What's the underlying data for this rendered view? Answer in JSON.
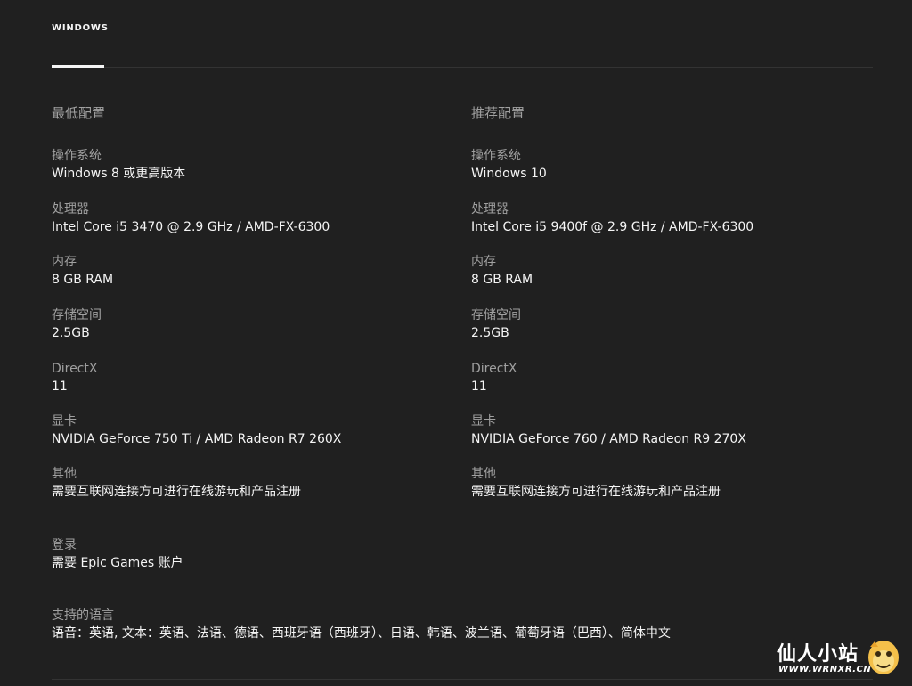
{
  "tabs": [
    {
      "label": "WINDOWS",
      "active": true
    }
  ],
  "minimum": {
    "heading": "最低配置",
    "specs": [
      {
        "label": "操作系统",
        "value": "Windows 8 或更高版本"
      },
      {
        "label": "处理器",
        "value": "Intel Core i5 3470 @ 2.9 GHz / AMD-FX-6300"
      },
      {
        "label": "内存",
        "value": "8 GB RAM"
      },
      {
        "label": "存储空间",
        "value": "2.5GB"
      },
      {
        "label": "DirectX",
        "value": "11"
      },
      {
        "label": "显卡",
        "value": "NVIDIA GeForce 750 Ti / AMD Radeon R7 260X"
      },
      {
        "label": "其他",
        "value": "需要互联网连接方可进行在线游玩和产品注册"
      }
    ]
  },
  "recommended": {
    "heading": "推荐配置",
    "specs": [
      {
        "label": "操作系统",
        "value": "Windows 10"
      },
      {
        "label": "处理器",
        "value": "Intel Core i5 9400f @ 2.9 GHz / AMD-FX-6300"
      },
      {
        "label": "内存",
        "value": "8 GB RAM"
      },
      {
        "label": "存储空间",
        "value": "2.5GB"
      },
      {
        "label": "DirectX",
        "value": "11"
      },
      {
        "label": "显卡",
        "value": "NVIDIA GeForce 760 / AMD Radeon R9 270X"
      },
      {
        "label": "其他",
        "value": "需要互联网连接方可进行在线游玩和产品注册"
      }
    ]
  },
  "login": {
    "label": "登录",
    "value": "需要 Epic Games 账户"
  },
  "languages": {
    "label": "支持的语言",
    "value": "语音：英语, 文本：英语、法语、德语、西班牙语（西班牙）、日语、韩语、波兰语、葡萄牙语（巴西）、简体中文"
  },
  "watermark": {
    "title": "仙人小站",
    "url": "WWW.WRNXR.CN",
    "mascot_icon": "mascot-icon"
  },
  "colors": {
    "background": "#202020",
    "label": "#a0a0a0",
    "value": "#f5f5f5",
    "divider": "#333333"
  }
}
